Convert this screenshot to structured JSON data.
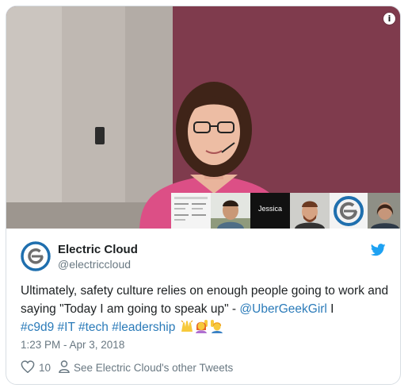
{
  "media": {
    "info_icon": "info-icon",
    "participant_tile_name": "Jessica"
  },
  "author": {
    "display_name": "Electric Cloud",
    "handle": "@electriccloud",
    "brand_color": "#1da1f2"
  },
  "tweet": {
    "text_part1": "Ultimately, safety culture relies on enough people going to work and saying \"Today I am going to speak up\" - ",
    "mention": "@UberGeekGirl",
    "text_part2": " I ",
    "hashtags": [
      "#c9d9",
      "#IT",
      "#tech",
      "#leadership"
    ],
    "emojis": [
      "raising-hands-emoji",
      "woman-raising-hand-emoji",
      "person-raising-hand-emoji"
    ],
    "timestamp": "1:23 PM - Apr 3, 2018"
  },
  "actions": {
    "like_count": "10",
    "other_tweets_label": "See Electric Cloud's other Tweets"
  },
  "colors": {
    "link": "#2b7bb9",
    "muted": "#697882",
    "text": "#1c2022"
  }
}
